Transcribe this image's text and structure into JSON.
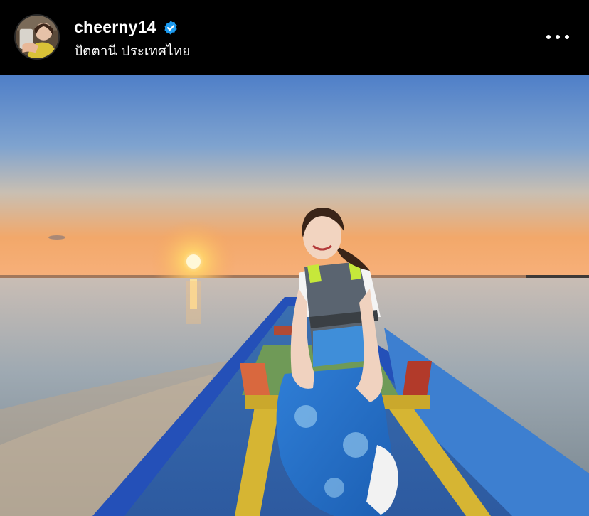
{
  "post": {
    "author": {
      "username": "cheerny14",
      "verified": true,
      "location": "ปัตตานี ประเทศไทย"
    },
    "menu_icon": "more-horizontal-icon",
    "verified_icon": "verified-badge-icon",
    "colors": {
      "background": "#000000",
      "text": "#ffffff",
      "verified_badge": "#1d9bf0"
    }
  }
}
